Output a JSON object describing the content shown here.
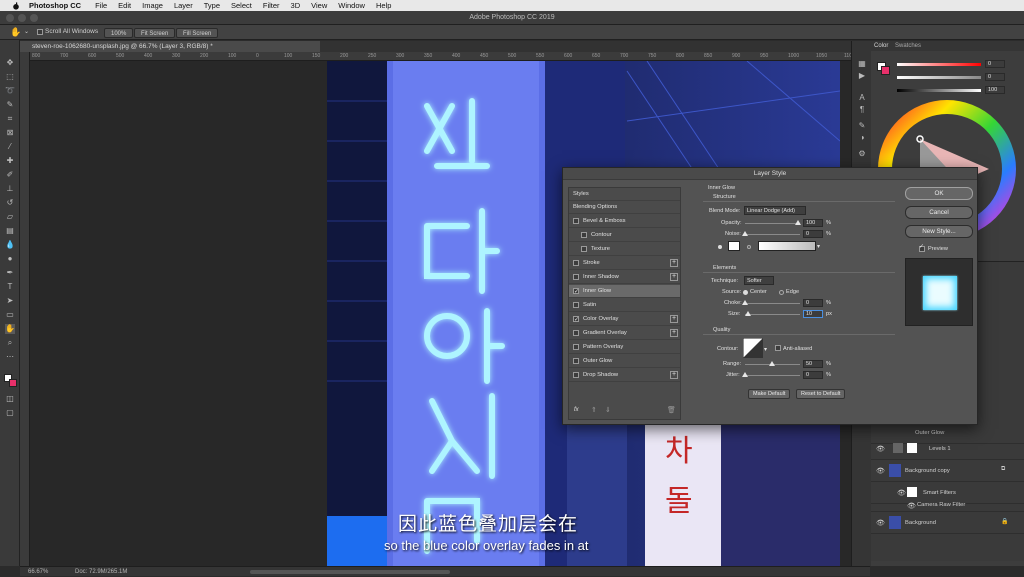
{
  "menubar": {
    "app_name": "Photoshop CC",
    "items": [
      "File",
      "Edit",
      "Image",
      "Layer",
      "Type",
      "Select",
      "Filter",
      "3D",
      "View",
      "Window",
      "Help"
    ]
  },
  "window": {
    "title": "Adobe Photoshop CC 2019"
  },
  "options_bar": {
    "scroll_all_windows": "Scroll All Windows",
    "zoom_100": "100%",
    "fit_screen": "Fit Screen",
    "fill_screen": "Fill Screen"
  },
  "document": {
    "tab_title": "steven-roe-1062680-unsplash.jpg @ 66.7% (Layer 3, RGB/8) *"
  },
  "ruler": {
    "ticks": [
      "800",
      "700",
      "600",
      "500",
      "400",
      "300",
      "200",
      "100",
      "0",
      "100",
      "150",
      "200",
      "250",
      "300",
      "350",
      "400",
      "450",
      "500",
      "550",
      "600",
      "650",
      "700",
      "750",
      "800",
      "850",
      "900",
      "950",
      "1000",
      "1050",
      "1100"
    ]
  },
  "status_bar": {
    "zoom": "66.67%",
    "doc": "Doc: 72.9M/265.1M"
  },
  "color_panel": {
    "tabs": [
      "Color",
      "Swatches"
    ],
    "values": [
      "0",
      "0",
      "100"
    ],
    "foreground": "#ffffff",
    "background": "#e8306a"
  },
  "layers_panel": {
    "rows": [
      {
        "name": "Outer Glow"
      },
      {
        "name": "Levels 1"
      },
      {
        "name": "Background copy"
      },
      {
        "name": "Smart Filters"
      },
      {
        "name": "Camera Raw Filter"
      },
      {
        "name": "Background"
      }
    ]
  },
  "dialog": {
    "title": "Layer Style",
    "styles": [
      {
        "label": "Styles",
        "checkbox": false,
        "checked": false,
        "plus": false,
        "selected": false
      },
      {
        "label": "Blending Options",
        "checkbox": false,
        "checked": false,
        "plus": false,
        "selected": false
      },
      {
        "label": "Bevel & Emboss",
        "checkbox": true,
        "checked": false,
        "plus": false,
        "selected": false
      },
      {
        "label": "Contour",
        "checkbox": true,
        "checked": false,
        "plus": false,
        "selected": false
      },
      {
        "label": "Texture",
        "checkbox": true,
        "checked": false,
        "plus": false,
        "selected": false
      },
      {
        "label": "Stroke",
        "checkbox": true,
        "checked": false,
        "plus": true,
        "selected": false
      },
      {
        "label": "Inner Shadow",
        "checkbox": true,
        "checked": false,
        "plus": true,
        "selected": false
      },
      {
        "label": "Inner Glow",
        "checkbox": true,
        "checked": true,
        "plus": false,
        "selected": true
      },
      {
        "label": "Satin",
        "checkbox": true,
        "checked": false,
        "plus": false,
        "selected": false
      },
      {
        "label": "Color Overlay",
        "checkbox": true,
        "checked": true,
        "plus": true,
        "selected": false
      },
      {
        "label": "Gradient Overlay",
        "checkbox": true,
        "checked": false,
        "plus": true,
        "selected": false
      },
      {
        "label": "Pattern Overlay",
        "checkbox": true,
        "checked": false,
        "plus": false,
        "selected": false
      },
      {
        "label": "Outer Glow",
        "checkbox": true,
        "checked": false,
        "plus": false,
        "selected": false
      },
      {
        "label": "Drop Shadow",
        "checkbox": true,
        "checked": false,
        "plus": true,
        "selected": false
      }
    ],
    "section_title": "Inner Glow",
    "structure": {
      "heading": "Structure",
      "blend_mode_label": "Blend Mode:",
      "blend_mode_value": "Linear Dodge (Add)",
      "opacity_label": "Opacity:",
      "opacity_value": "100",
      "noise_label": "Noise:",
      "noise_value": "0",
      "percent": "%",
      "opacity_level": 1.0,
      "noise_level": 0.0
    },
    "elements": {
      "heading": "Elements",
      "technique_label": "Technique:",
      "technique_value": "Softer",
      "source_label": "Source:",
      "source_center": "Center",
      "source_edge": "Edge",
      "choke_label": "Choke:",
      "choke_value": "0",
      "size_label": "Size:",
      "size_value": "10",
      "px": "px",
      "choke_level": 0.0,
      "size_level": 0.04
    },
    "quality": {
      "heading": "Quality",
      "contour_label": "Contour:",
      "anti_aliased": "Anti-aliased",
      "range_label": "Range:",
      "range_value": "50",
      "jitter_label": "Jitter:",
      "jitter_value": "0",
      "range_level": 0.5,
      "jitter_level": 0.0
    },
    "make_default": "Make Default",
    "reset_default": "Reset to Default",
    "ok": "OK",
    "cancel": "Cancel",
    "new_style": "New Style...",
    "preview": "Preview",
    "fx": "fx"
  },
  "subtitles": {
    "chinese": "因此蓝色叠加层会在",
    "english": "so the blue color overlay fades in at"
  }
}
